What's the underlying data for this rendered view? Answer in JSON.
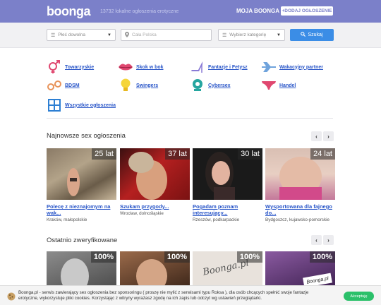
{
  "header": {
    "logo": "boonga",
    "tagline": "13732 lokalne ogłoszenia erotyczne",
    "account_link": "MOJA BOONGA",
    "add_button": "+DODAJ OGŁOSZENIE"
  },
  "search": {
    "gender_select": "Płeć dowolna",
    "location_placeholder": "Cała Polska",
    "category_select": "Wybierz kategorię",
    "submit_label": "Szukaj"
  },
  "categories": [
    {
      "label": "Towarzyskie",
      "icon": "gender-symbols-icon"
    },
    {
      "label": "Skok w bok",
      "icon": "lips-icon"
    },
    {
      "label": "Fantazje i Fetysz",
      "icon": "high-heel-icon"
    },
    {
      "label": "Wakacyjny partner",
      "icon": "airplane-icon"
    },
    {
      "label": "BDSM",
      "icon": "handcuffs-icon"
    },
    {
      "label": "Swingers",
      "icon": "bulb-icon"
    },
    {
      "label": "Cybersex",
      "icon": "webcam-icon"
    },
    {
      "label": "Handel",
      "icon": "underwear-icon"
    },
    {
      "label": "Wszystkie ogłoszenia",
      "icon": "grid-icon"
    }
  ],
  "newest": {
    "title": "Najnowsze sex ogłoszenia",
    "cards": [
      {
        "age": "25 lat",
        "title": "Polecę z nieznajomym na wak...",
        "location": "Kraków, małopolskie"
      },
      {
        "age": "37 lat",
        "title": "Szukam przygody...",
        "location": "Wrocław, dolnośląskie"
      },
      {
        "age": "30 lat",
        "title": "Pogadam poznam interesujący...",
        "location": "Rzeszów, podkarpackie"
      },
      {
        "age": "24 lat",
        "title": "Wysportowana dla fajnego do...",
        "location": "Bydgoszcz, kujawsko-pomorskie"
      }
    ]
  },
  "verified": {
    "title": "Ostatnio zweryfikowane",
    "cards": [
      {
        "percent": "100%"
      },
      {
        "percent": "100%"
      },
      {
        "percent": "100%",
        "sign": "Boonga.pl"
      },
      {
        "percent": "100%",
        "sign": "Boonga.pl"
      }
    ]
  },
  "cookie": {
    "text": "Boonga.pl - serwis zawierający sex ogłoszenia bez sponsoringu ( proszę nie mylić z serwisami typu Roksa ), dla osób chcących spełnić swoje fantazje erotyczne, wykorzystuje pliki cookies. Korzystając z witryny wyrażasz zgodę na ich zapis lub odczyt wg ustawień przeglądarki.",
    "accept_label": "Akceptuję"
  },
  "colors": {
    "header_bg": "#7b80c9",
    "link": "#2855c8",
    "search_button": "#3b8de6",
    "accept_button": "#2bc06a",
    "category_icon": "#e04870"
  }
}
